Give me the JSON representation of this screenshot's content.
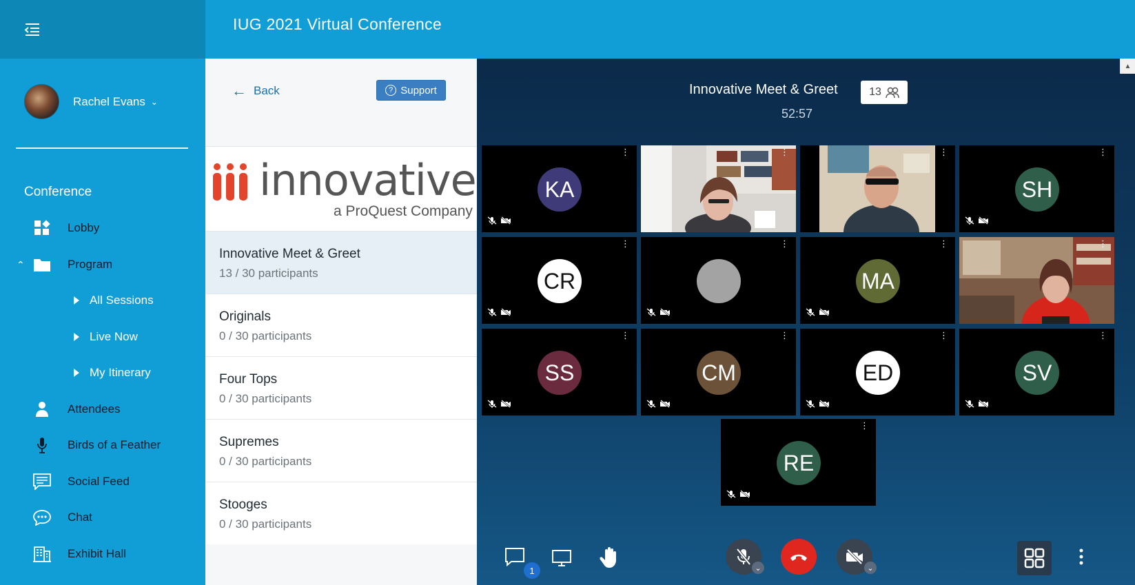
{
  "header": {
    "title": "IUG 2021 Virtual Conference"
  },
  "user": {
    "name": "Rachel Evans"
  },
  "sidebar": {
    "section": "Conference",
    "items": [
      {
        "label": "Lobby",
        "icon": "dashboard-icon"
      },
      {
        "label": "Program",
        "icon": "folder-icon"
      },
      {
        "label": "All Sessions",
        "icon": "caret-right-icon"
      },
      {
        "label": "Live Now",
        "icon": "caret-right-icon"
      },
      {
        "label": "My Itinerary",
        "icon": "caret-right-icon"
      },
      {
        "label": "Attendees",
        "icon": "person-icon"
      },
      {
        "label": "Birds of a Feather",
        "icon": "microphone-icon"
      },
      {
        "label": "Social Feed",
        "icon": "comment-icon"
      },
      {
        "label": "Chat",
        "icon": "chat-bubble-icon"
      },
      {
        "label": "Exhibit Hall",
        "icon": "building-icon"
      }
    ]
  },
  "rooms_panel": {
    "back_label": "Back",
    "support_label": "Support",
    "logo": {
      "word": "innovative",
      "sub": "a ProQuest Company"
    },
    "rooms": [
      {
        "name": "Innovative Meet & Greet",
        "count": "13 / 30 participants"
      },
      {
        "name": "Originals",
        "count": "0 / 30 participants"
      },
      {
        "name": "Four Tops",
        "count": "0 / 30 participants"
      },
      {
        "name": "Supremes",
        "count": "0 / 30 participants"
      },
      {
        "name": "Stooges",
        "count": "0 / 30 participants"
      }
    ]
  },
  "meeting": {
    "title": "Innovative Meet & Greet",
    "participant_count": "13",
    "timer": "52:57",
    "participants": [
      {
        "initials": "KA",
        "color": "#3f3a78"
      },
      {
        "initials": "",
        "video": "woman-office"
      },
      {
        "initials": "",
        "video": "man-glasses"
      },
      {
        "initials": "SH",
        "color": "#2f5e4a"
      },
      {
        "initials": "CR",
        "color": "#ffffff",
        "text_color": "#111111"
      },
      {
        "initials": "",
        "color": "#a3a3a3"
      },
      {
        "initials": "MA",
        "color": "#5f6a35"
      },
      {
        "initials": "",
        "video": "woman-red-jacket"
      },
      {
        "initials": "SS",
        "color": "#6b2b3e"
      },
      {
        "initials": "CM",
        "color": "#6b5238"
      },
      {
        "initials": "ED",
        "color": "#ffffff",
        "text_color": "#111111"
      },
      {
        "initials": "SV",
        "color": "#2f5e4a"
      },
      {
        "initials": "RE",
        "color": "#2f5e4a"
      }
    ],
    "chat_badge": "1"
  }
}
